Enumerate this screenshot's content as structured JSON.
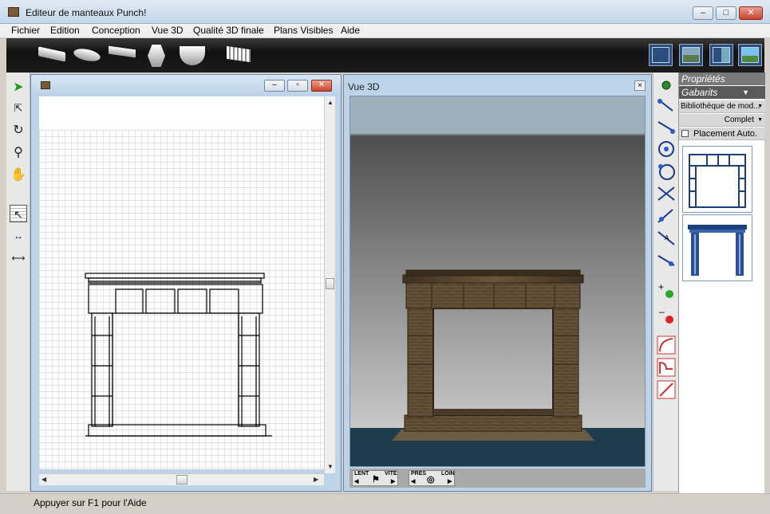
{
  "window": {
    "title": "Editeur de manteaux Punch!",
    "minimize_icon": "minimize-icon",
    "maximize_icon": "maximize-icon",
    "close_icon": "close-icon"
  },
  "menu": {
    "items": [
      "Fichier",
      "Edition",
      "Conception",
      "Vue 3D",
      "Qualité 3D finale",
      "Plans Visibles",
      "Aide"
    ]
  },
  "toolbar": {
    "molding_shapes": [
      "molding-straight-icon",
      "molding-oval-icon",
      "molding-angle-icon",
      "molding-hex-icon",
      "molding-curve-icon",
      "molding-dentil-icon"
    ],
    "view_buttons": [
      "plan-view-icon",
      "elevation-view-icon",
      "split-view-icon",
      "3d-view-icon"
    ]
  },
  "left_tools": [
    "select-arrow-icon",
    "select-points-icon",
    "rotate-icon",
    "zoom-icon",
    "pan-hand-icon",
    "select-grid-icon",
    "dimension-grid-icon",
    "dimension-plane-icon"
  ],
  "panel2d": {
    "title": "",
    "buttons": {
      "minimize": "minimize-icon",
      "restore": "restore-icon",
      "close": "close-icon"
    }
  },
  "panel3d": {
    "title": "Vue 3D",
    "close_label": "×",
    "nav": {
      "speed_slow": "LENT",
      "speed_fast": "VITE",
      "distance_near": "PRES",
      "distance_far": "LOIN"
    }
  },
  "right_tools": [
    "point-icon",
    "line-point-icon",
    "line-point-end-icon",
    "circle-center-icon",
    "circle-edge-icon",
    "line-intersect-icon",
    "line-angle-icon",
    "line-label-icon",
    "line-extend-icon",
    "add-point-icon",
    "remove-point-icon",
    "arc-tool-icon",
    "curve-tool-icon",
    "fillet-tool-icon"
  ],
  "properties": {
    "header": "Propriétés",
    "tab": "Gabarits",
    "library_select": "Bibliothèque de mod...",
    "filter_select": "Complet",
    "auto_place_label": "Placement Auto.",
    "auto_place_checked": false,
    "templates": [
      "mantel-template-1",
      "mantel-template-2"
    ]
  },
  "colors": {
    "toolbar_dark": "#1c1c1c",
    "panel_border": "#6a87a8",
    "sky": "#9eb0bb",
    "floor": "#1e3c4c",
    "wood": "#5a4731"
  },
  "status": {
    "text": "Appuyer sur F1 pour l'Aide"
  }
}
